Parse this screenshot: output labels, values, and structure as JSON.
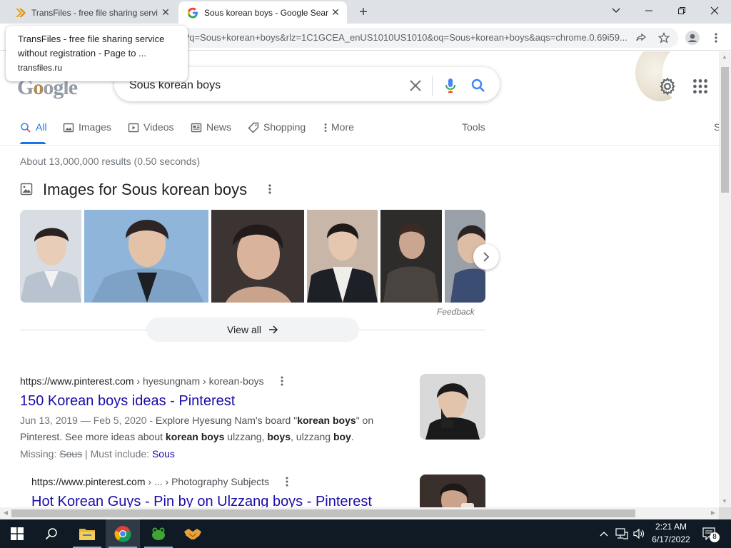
{
  "tabs": [
    {
      "title": "TransFiles - free file sharing servi",
      "active": false
    },
    {
      "title": "Sous korean boys - Google Searc",
      "active": true
    }
  ],
  "toolbar": {
    "url": "?q=Sous+korean+boys&rlz=1C1GCEA_enUS1010US1010&oq=Sous+korean+boys&aqs=chrome.0.69i59..."
  },
  "hovercard": {
    "title": "TransFiles - free file sharing service without registration - Page to ...",
    "url": "transfiles.ru"
  },
  "search": {
    "logo_text": "Google",
    "query": "Sous korean boys"
  },
  "nav": {
    "all": "All",
    "images": "Images",
    "videos": "Videos",
    "news": "News",
    "shopping": "Shopping",
    "more": "More",
    "tools": "Tools",
    "cut": "S"
  },
  "stats": "About 13,000,000 results (0.50 seconds)",
  "images_block": {
    "header": "Images for Sous korean boys",
    "feedback": "Feedback",
    "view_all": "View all"
  },
  "results": [
    {
      "url": "https://www.pinterest.com",
      "breadcrumb": " › hyesungnam › korean-boys",
      "title": "150 Korean boys ideas - Pinterest",
      "date": "Jun 13, 2019 — Feb 5, 2020 - ",
      "snippet_a": "Explore Hyesung Nam's board \"",
      "snippet_b1": "korean boys",
      "snippet_c": "\" on Pinterest. See more ideas about ",
      "snippet_b2": "korean boys",
      "snippet_d": " ulzzang, ",
      "snippet_b3": "boys",
      "snippet_e": ", ulzzang ",
      "snippet_b4": "boy",
      "snippet_f": ".",
      "missing_label": "Missing: ",
      "missing_word": "Sous",
      "must_label": " | Must include: ",
      "must_word": "Sous"
    },
    {
      "url": "https://www.pinterest.com",
      "breadcrumb": " › ... › Photography Subjects",
      "title": "Hot Korean Guys - Pin by on Ulzzang boys - Pinterest"
    }
  ],
  "taskbar": {
    "time": "2:21 AM",
    "date": "6/17/2022",
    "notifications": "8"
  },
  "colors": {
    "link": "#1a0dab",
    "accent": "#1a73e8",
    "taskbar": "#0f1a24"
  }
}
